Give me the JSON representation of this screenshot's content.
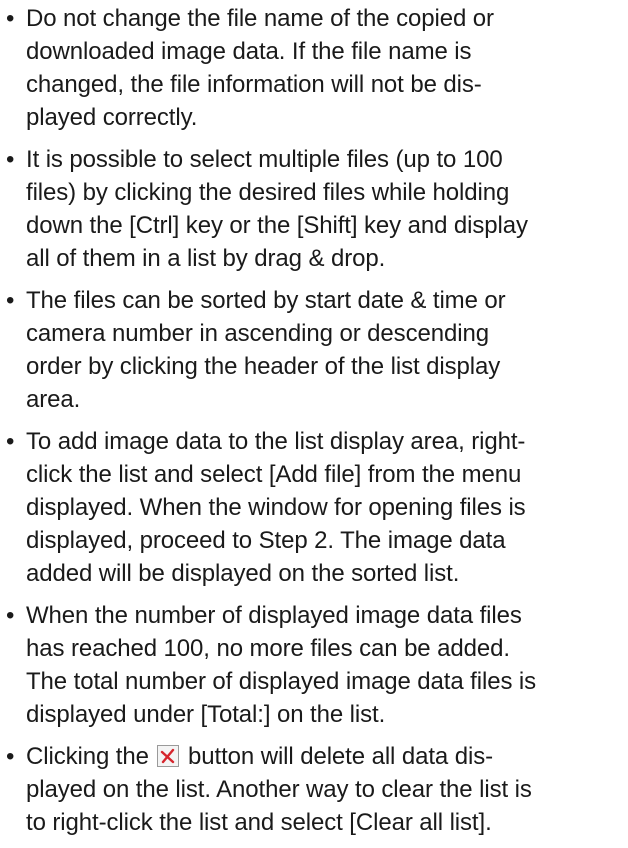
{
  "notes": [
    {
      "lines": [
        "Do not change the file name of the copied or",
        "downloaded image data. If the file name is",
        "changed, the file information will not be dis-",
        "played correctly."
      ]
    },
    {
      "lines": [
        "It is possible to select multiple files (up to 100",
        "files) by clicking the desired files while holding",
        "down the [Ctrl] key or the [Shift] key and display",
        "all of them in a list by drag & drop."
      ]
    },
    {
      "lines": [
        "The files can be sorted by start date & time or",
        "camera number in ascending or descending",
        "order by clicking the header of the list display",
        "area."
      ]
    },
    {
      "lines": [
        "To add image data to the list display area, right-",
        "click the list and select [Add file] from the menu",
        "displayed. When the window for opening files is",
        "displayed, proceed to Step 2. The image data",
        "added will be displayed on the sorted list."
      ]
    },
    {
      "lines": [
        "When the number of displayed image data files",
        "has reached 100, no more files can be added.",
        "The total number of displayed image data files is",
        "displayed under [Total:] on the list."
      ]
    },
    {
      "line1_before_icon": "Clicking the",
      "line1_after_icon": "button will delete all data dis-",
      "lines": [
        "played on the list. Another way to clear the list is",
        "to right-click the list and select [Clear all list]."
      ]
    }
  ],
  "bullet_glyph": "•",
  "icon": {
    "name": "clear-list-icon",
    "color": "#d6252d"
  }
}
